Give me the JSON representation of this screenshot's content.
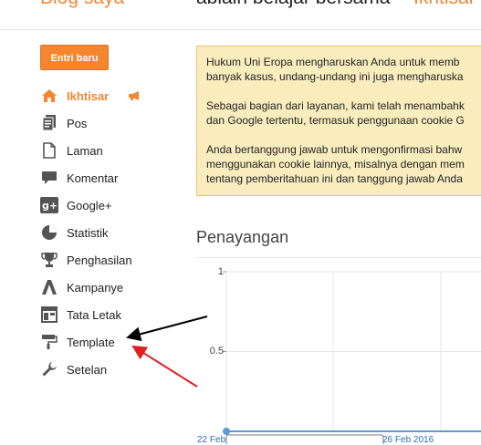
{
  "header": {
    "blog_title": "Blog saya",
    "post_title": "ablain belajar bersama",
    "section_title": "Ikhtisar"
  },
  "toolbar": {
    "new_post_label": "Entri baru"
  },
  "sidebar": {
    "items": [
      {
        "label": "Ikhtisar",
        "icon": "home-icon",
        "active": true
      },
      {
        "label": "Pos",
        "icon": "posts-icon"
      },
      {
        "label": "Laman",
        "icon": "pages-icon"
      },
      {
        "label": "Komentar",
        "icon": "comments-icon"
      },
      {
        "label": "Google+",
        "icon": "google-plus-icon"
      },
      {
        "label": "Statistik",
        "icon": "pie-chart-icon"
      },
      {
        "label": "Penghasilan",
        "icon": "trophy-icon"
      },
      {
        "label": "Kampanye",
        "icon": "adwords-icon"
      },
      {
        "label": "Tata Letak",
        "icon": "layout-icon"
      },
      {
        "label": "Template",
        "icon": "paint-roller-icon"
      },
      {
        "label": "Setelan",
        "icon": "wrench-icon"
      }
    ]
  },
  "notice": {
    "lines": [
      "Hukum Uni Eropa mengharuskan Anda untuk memb",
      "banyak kasus, undang-undang ini juga mengharuska",
      "Sebagai bagian dari layanan, kami telah menambahk",
      "dan Google tertentu, termasuk penggunaan cookie G",
      "Anda bertanggung jawab untuk mengonfirmasi bahw",
      "menggunakan cookie lainnya, misalnya dengan mem",
      "tentang pemberitahuan ini dan tanggung jawab Anda"
    ]
  },
  "stats": {
    "title": "Penayangan"
  },
  "chart_data": {
    "type": "line",
    "y_ticks": [
      "1",
      "0.5"
    ],
    "x_ticks": [
      "22 Feb",
      "26 Feb 2016"
    ],
    "ylim": [
      0,
      1
    ],
    "grid": true,
    "series": [
      {
        "values": [
          0
        ]
      }
    ],
    "colors": {
      "line": "#5b9bd5",
      "grid": "#e5e5e5"
    }
  },
  "colors": {
    "accent": "#f48630",
    "notice_bg": "#f9edbe",
    "arrow_black": "#000000",
    "arrow_red": "#e02020"
  }
}
